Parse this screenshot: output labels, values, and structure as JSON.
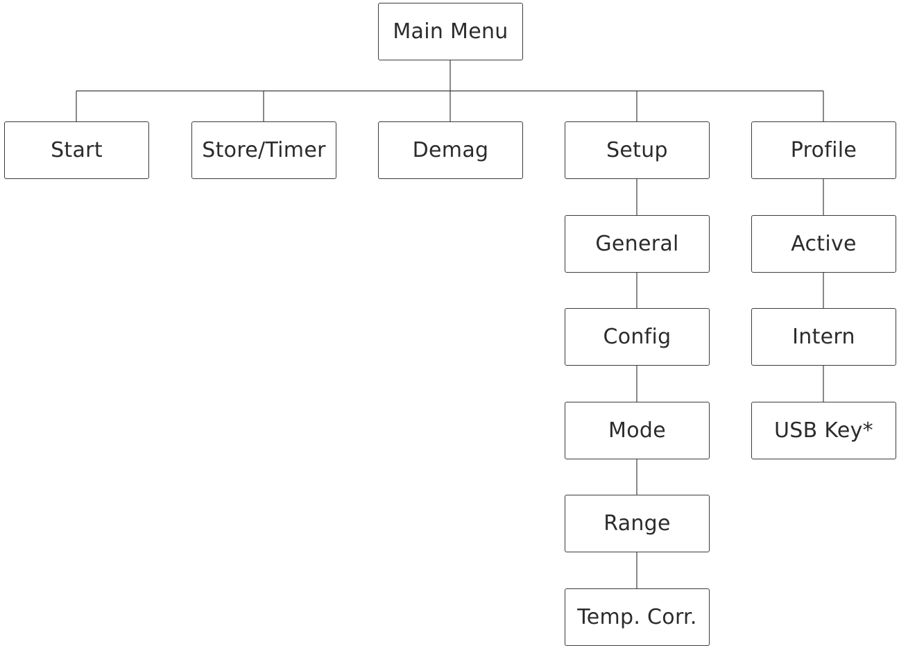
{
  "root": {
    "label": "Main Menu"
  },
  "top_level": {
    "start": {
      "label": "Start"
    },
    "store_timer": {
      "label": "Store/Timer"
    },
    "demag": {
      "label": "Demag"
    },
    "setup": {
      "label": "Setup"
    },
    "profile": {
      "label": "Profile"
    }
  },
  "setup_children": {
    "general": {
      "label": "General"
    },
    "config": {
      "label": "Config"
    },
    "mode": {
      "label": "Mode"
    },
    "range": {
      "label": "Range"
    },
    "temp_corr": {
      "label": "Temp. Corr."
    }
  },
  "profile_children": {
    "active": {
      "label": "Active"
    },
    "intern": {
      "label": "Intern"
    },
    "usb_key": {
      "label": "USB Key*"
    }
  }
}
